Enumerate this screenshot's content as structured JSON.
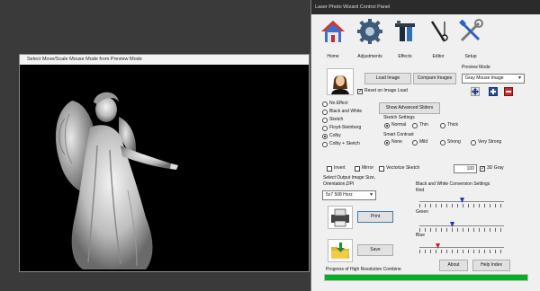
{
  "preview": {
    "title": "Select Move/Scale Mouse Mode from Preview Mode"
  },
  "panel": {
    "title": "Laser Photo Wizard Control Panel",
    "toolbar": [
      {
        "label": "Home",
        "icon": "home-icon"
      },
      {
        "label": "Adjustments",
        "icon": "gear-icon"
      },
      {
        "label": "Effects",
        "icon": "effects-icon"
      },
      {
        "label": "Editor",
        "icon": "editor-icon"
      },
      {
        "label": "Setup",
        "icon": "setup-icon"
      }
    ],
    "buttons": {
      "load_image": "Load Image",
      "compare_images": "Compare Images",
      "advanced_sliders": "Show Advanced Sliders",
      "print": "Print",
      "save": "Save",
      "about": "About",
      "help_index": "Help Index"
    },
    "preview_mode": {
      "label": "Preview Mode",
      "selected": "Gray Mouse Image"
    },
    "reset_on_load": {
      "label": "Reset on Image Load",
      "checked": true
    },
    "effects": [
      {
        "label": "No Effect",
        "checked": false
      },
      {
        "label": "Black and White",
        "checked": false
      },
      {
        "label": "Sketch",
        "checked": false
      },
      {
        "label": "Floyd-Steinberg",
        "checked": false
      },
      {
        "label": "Colby",
        "checked": true
      },
      {
        "label": "Colby + Sketch",
        "checked": false
      }
    ],
    "sketch_settings": {
      "label": "Sketch Settings",
      "options": [
        {
          "label": "Normal",
          "checked": true
        },
        {
          "label": "Thin",
          "checked": false
        },
        {
          "label": "Thick",
          "checked": false
        }
      ]
    },
    "smart_contrast": {
      "label": "Smart Contrast",
      "options": [
        {
          "label": "None",
          "checked": true
        },
        {
          "label": "Mild",
          "checked": false
        },
        {
          "label": "Strong",
          "checked": false
        },
        {
          "label": "Very Strong",
          "checked": false
        }
      ]
    },
    "options": [
      {
        "label": "Invert",
        "checked": false
      },
      {
        "label": "Mirror",
        "checked": false
      },
      {
        "label": "Vectorize Sketch",
        "checked": false
      }
    ],
    "value_box": "100",
    "gray_3d": {
      "label": "3D Gray",
      "checked": true
    },
    "output_size": {
      "label_line1": "Select Output Image Size,",
      "label_line2": "Orientation,DPI",
      "selected": "5x7 508 Horz"
    },
    "bw_conversion": {
      "label": "Black and White Conversion Settings",
      "sliders": [
        {
          "label": "Red",
          "value": 0.5
        },
        {
          "label": "Green",
          "value": 0.38
        },
        {
          "label": "Blue",
          "value": 0.2
        }
      ]
    },
    "progress": {
      "label": "Progress of High Resolution Combine",
      "value": 1.0
    },
    "colors": {
      "progress_green": "#06b025",
      "slider_thumb_blue": "#2233cc",
      "slider_thumb_red": "#cc2222",
      "mini_button_blue": "#2a4ea8",
      "mini_button_red": "#c62c2c"
    }
  }
}
